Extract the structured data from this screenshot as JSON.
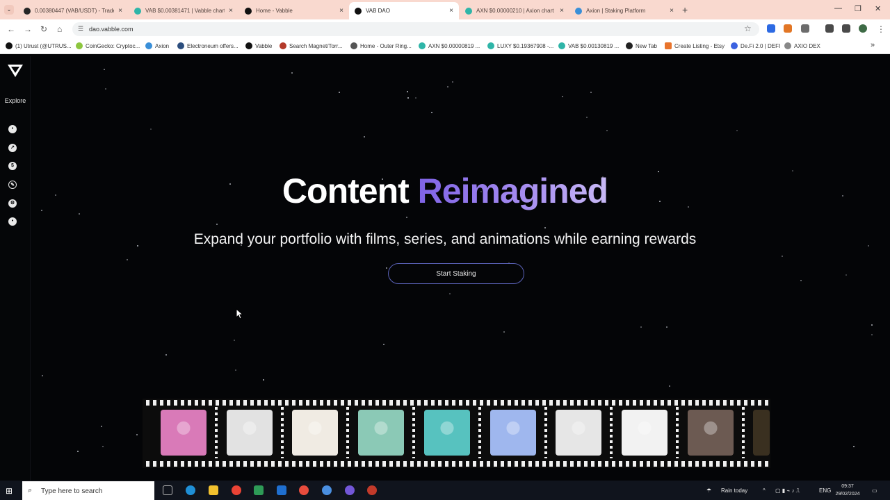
{
  "browser": {
    "tabs": [
      {
        "label": "0.00380447 (VAB/USDT) - Trade",
        "color": "#262626"
      },
      {
        "label": "VAB $0.00381471 | Vabble chart",
        "color": "#2fb5a8"
      },
      {
        "label": "Home - Vabble",
        "color": "#111111"
      },
      {
        "label": "VAB DAO",
        "color": "#111111"
      },
      {
        "label": "AXN $0.00000210 | Axion chart",
        "color": "#2fb5a8"
      },
      {
        "label": "Axion | Staking Platform",
        "color": "#3a8fd8"
      }
    ],
    "active_tab_index": 3,
    "url": "dao.vabble.com",
    "bookmarks": [
      {
        "label": "(1) Utrust (@UTRUS...",
        "color": "#111111"
      },
      {
        "label": "CoinGecko: Cryptoc...",
        "color": "#8dc63f"
      },
      {
        "label": "Axion",
        "color": "#3a8fd8"
      },
      {
        "label": "Electroneum offers...",
        "color": "#2c4e7e"
      },
      {
        "label": "Vabble",
        "color": "#111111"
      },
      {
        "label": "Search Magnet/Torr...",
        "color": "#b33a2a"
      },
      {
        "label": "Home - Outer Ring...",
        "color": "#555555"
      },
      {
        "label": "AXN $0.00000819 ...",
        "color": "#2fb5a8"
      },
      {
        "label": "LUXY $0.19367908 -...",
        "color": "#2fb5a8"
      },
      {
        "label": "VAB $0.00130819 ...",
        "color": "#2fb5a8"
      },
      {
        "label": "New Tab",
        "color": "#222222"
      },
      {
        "label": "Create Listing - Etsy",
        "color": "#e8742c"
      },
      {
        "label": "De.Fi 2.0 | DEFI",
        "color": "#3b62e0"
      },
      {
        "label": "AXIO DEX",
        "color": "#888888"
      }
    ]
  },
  "page": {
    "sidebar": {
      "explore_label": "Explore",
      "icons": [
        "chat-icon",
        "chart-icon",
        "dollar-icon",
        "edit-icon",
        "settings-icon",
        "message-icon"
      ]
    },
    "hero": {
      "headline_part1": "Content",
      "headline_part2": "Reimagined",
      "subheadline": "Expand your portfolio with films, series, and animations while earning rewards",
      "cta_label": "Start Staking"
    },
    "filmstrip": {
      "items": [
        {
          "name": "winged-character",
          "color": "#d97ab8"
        },
        {
          "name": "white-hair-character",
          "color": "#e2e2e2"
        },
        {
          "name": "red-hair-character",
          "color": "#f0ebe3"
        },
        {
          "name": "rainbow-visor-ape",
          "color": "#8bc9b6"
        },
        {
          "name": "fez-monkey",
          "color": "#57c2bf"
        },
        {
          "name": "shark-costume",
          "color": "#9fb7ee"
        },
        {
          "name": "crowned-ape",
          "color": "#e6e6e6"
        },
        {
          "name": "robot-character",
          "color": "#f2f2f2"
        },
        {
          "name": "hooded-girl",
          "color": "#6c5a52"
        }
      ]
    }
  },
  "taskbar": {
    "search_placeholder": "Type here to search",
    "weather": "Rain today",
    "language": "ENG",
    "time": "09:37",
    "date": "29/02/2024"
  }
}
